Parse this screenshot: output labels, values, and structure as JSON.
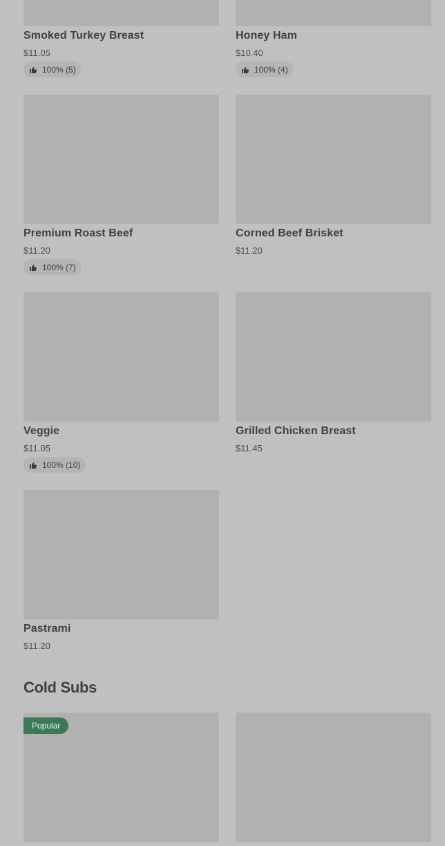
{
  "items": [
    {
      "name": "Smoked Turkey Breast",
      "price": "$11.05",
      "rating": "100% (5)"
    },
    {
      "name": "Honey Ham",
      "price": "$10.40",
      "rating": "100% (4)"
    },
    {
      "name": "Premium Roast Beef",
      "price": "$11.20",
      "rating": "100% (7)"
    },
    {
      "name": "Corned Beef Brisket",
      "price": "$11.20",
      "rating": null
    },
    {
      "name": "Veggie",
      "price": "$11.05",
      "rating": "100% (10)"
    },
    {
      "name": "Grilled Chicken Breast",
      "price": "$11.45",
      "rating": null
    },
    {
      "name": "Pastrami",
      "price": "$11.20",
      "rating": null
    }
  ],
  "section": {
    "title": "Cold Subs",
    "popular_badge": "Popular"
  },
  "icons": {
    "rating": "thumbs-up-icon"
  },
  "colors": {
    "background": "#c0c0c0",
    "image_placeholder": "#b1b1b1",
    "rating_pill": "#b5b5b5",
    "popular_badge": "#3c7a57"
  }
}
